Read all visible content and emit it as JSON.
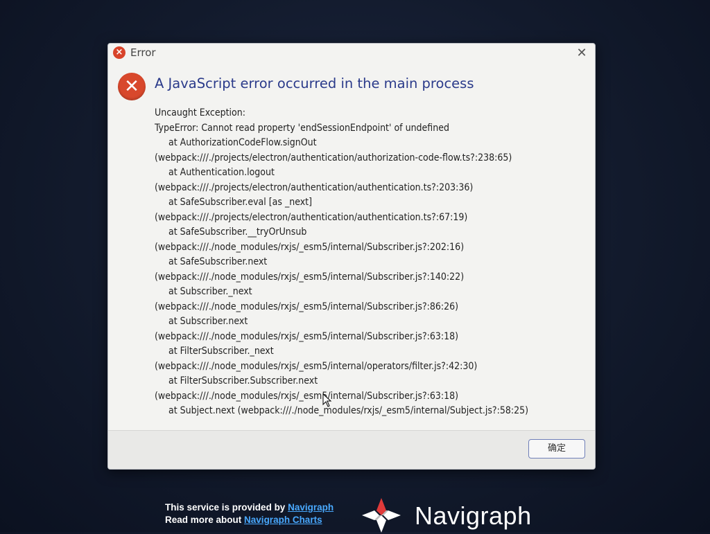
{
  "dialog": {
    "title": "Error",
    "headline": "A JavaScript error occurred in the main process",
    "lines": [
      {
        "text": "Uncaught Exception:",
        "indent": false
      },
      {
        "text": "TypeError: Cannot read property 'endSessionEndpoint' of undefined",
        "indent": false
      },
      {
        "text": "at AuthorizationCodeFlow.signOut",
        "indent": true
      },
      {
        "text": "(webpack:///./projects/electron/authentication/authorization-code-flow.ts?:238:65)",
        "indent": false
      },
      {
        "text": "at Authentication.logout",
        "indent": true
      },
      {
        "text": "(webpack:///./projects/electron/authentication/authentication.ts?:203:36)",
        "indent": false
      },
      {
        "text": "at SafeSubscriber.eval [as _next]",
        "indent": true
      },
      {
        "text": "(webpack:///./projects/electron/authentication/authentication.ts?:67:19)",
        "indent": false
      },
      {
        "text": "at SafeSubscriber.__tryOrUnsub",
        "indent": true
      },
      {
        "text": "(webpack:///./node_modules/rxjs/_esm5/internal/Subscriber.js?:202:16)",
        "indent": false
      },
      {
        "text": "at SafeSubscriber.next",
        "indent": true
      },
      {
        "text": "(webpack:///./node_modules/rxjs/_esm5/internal/Subscriber.js?:140:22)",
        "indent": false
      },
      {
        "text": "at Subscriber._next",
        "indent": true
      },
      {
        "text": "(webpack:///./node_modules/rxjs/_esm5/internal/Subscriber.js?:86:26)",
        "indent": false
      },
      {
        "text": "at Subscriber.next",
        "indent": true
      },
      {
        "text": "(webpack:///./node_modules/rxjs/_esm5/internal/Subscriber.js?:63:18)",
        "indent": false
      },
      {
        "text": "at FilterSubscriber._next",
        "indent": true
      },
      {
        "text": "(webpack:///./node_modules/rxjs/_esm5/internal/operators/filter.js?:42:30)",
        "indent": false
      },
      {
        "text": "at FilterSubscriber.Subscriber.next",
        "indent": true
      },
      {
        "text": "(webpack:///./node_modules/rxjs/_esm5/internal/Subscriber.js?:63:18)",
        "indent": false
      },
      {
        "text": "at Subject.next (webpack:///./node_modules/rxjs/_esm5/internal/Subject.js?:58:25)",
        "indent": true
      }
    ],
    "ok_label": "确定",
    "colors": {
      "error_red": "#d8482c",
      "headline_blue": "#2a3a8a",
      "button_border": "#6f7fb8"
    },
    "icons": {
      "title": "error-icon",
      "main": "error-icon",
      "close": "close-icon"
    }
  },
  "footer_brand": {
    "provided_prefix": "This service is provided by",
    "provided_link": "Navigraph",
    "read_prefix": "Read more about",
    "read_link": "Navigraph Charts",
    "logo_text": "Navigraph",
    "link_color": "#49a9ff"
  }
}
